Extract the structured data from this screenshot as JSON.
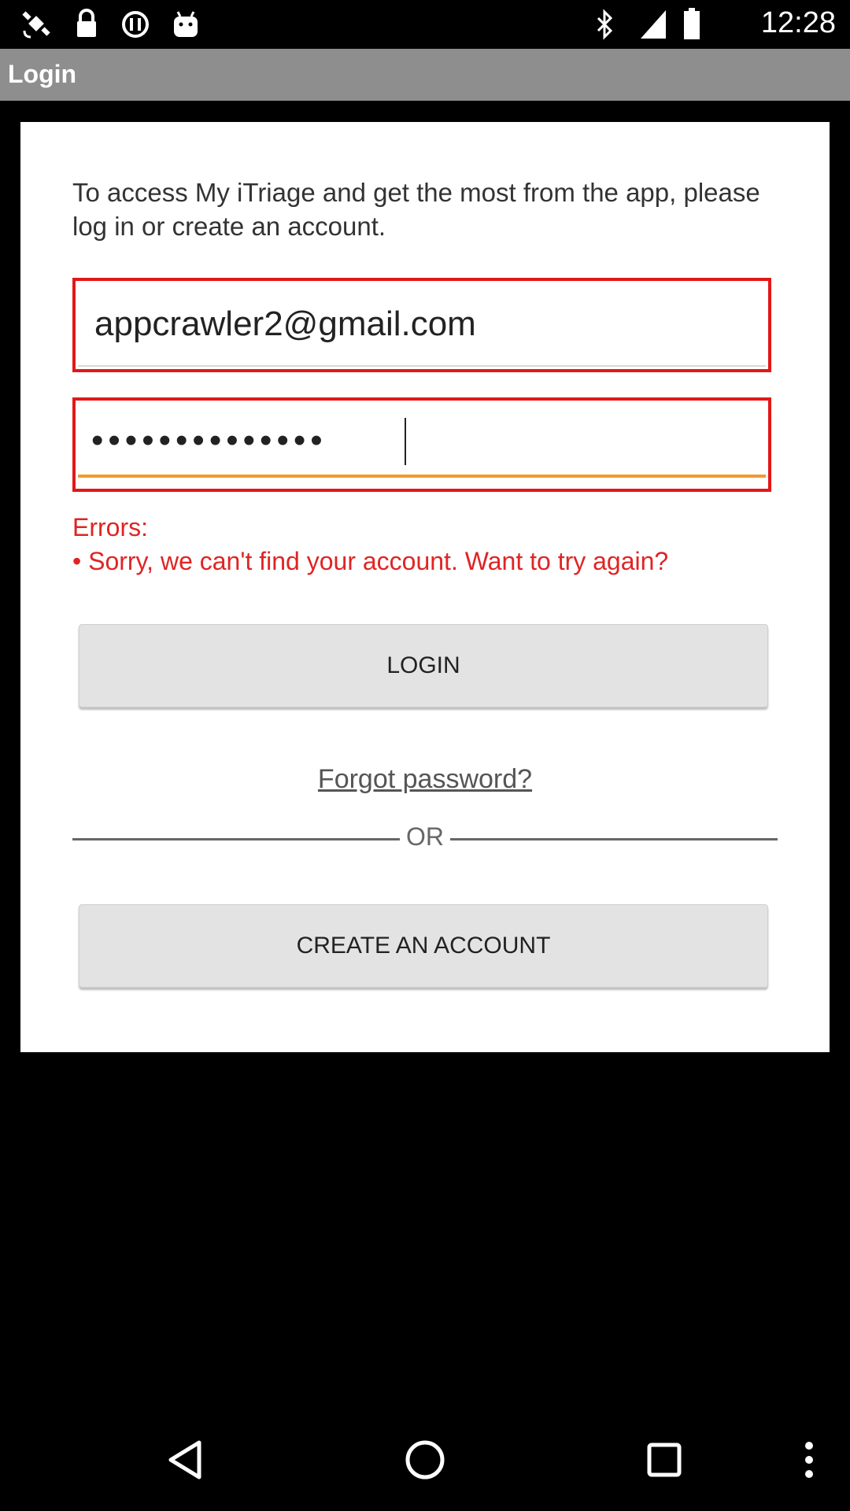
{
  "status_bar": {
    "time": "12:28",
    "icons_left": [
      "fake-gps-icon",
      "lock-icon",
      "info-icon",
      "android-icon"
    ],
    "icons_right": [
      "bluetooth-icon",
      "signal-icon",
      "battery-icon"
    ]
  },
  "action_bar": {
    "title": "Login"
  },
  "form": {
    "intro": "To access My iTriage and get the most from the app, please log in or create an account.",
    "email_value": "appcrawler2@gmail.com",
    "password_value": "••••••••••••••",
    "errors_label": "Errors:",
    "error_message": "• Sorry, we can't find your account. Want to try again?",
    "login_label": "LOGIN",
    "forgot_label": "Forgot password?",
    "or_label": "OR",
    "create_label": "CREATE AN ACCOUNT"
  },
  "colors": {
    "error_border": "#e21818",
    "error_text": "#e02424",
    "focus_underline": "#f39a2b",
    "action_bar": "#8e8e8e"
  },
  "nav_bar": {
    "buttons": [
      "back-icon",
      "home-icon",
      "recents-icon",
      "menu-icon"
    ]
  }
}
